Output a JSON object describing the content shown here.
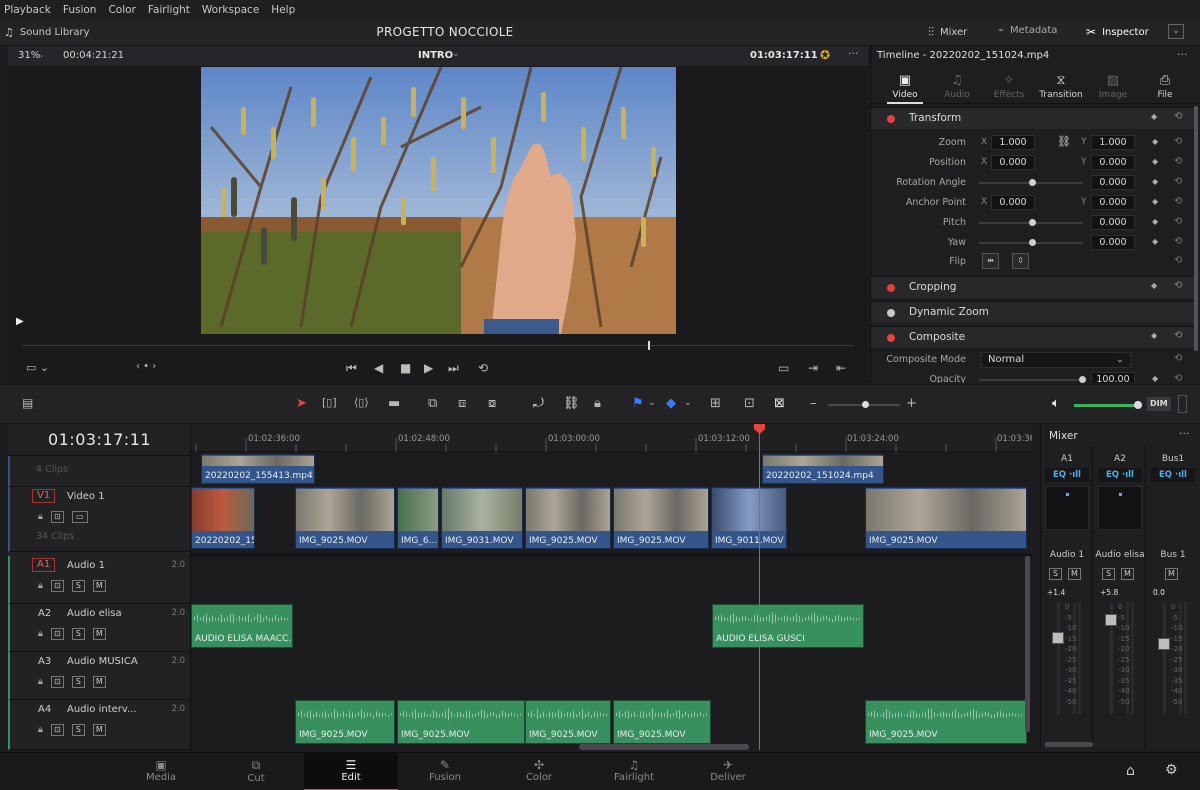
{
  "menu": [
    "Playback",
    "Fusion",
    "Color",
    "Fairlight",
    "Workspace",
    "Help"
  ],
  "header": {
    "sound_library": "Sound Library",
    "project_title": "PROGETTO NOCCIOLE",
    "mixer": "Mixer",
    "metadata": "Metadata",
    "inspector": "Inspector"
  },
  "viewer": {
    "zoom": "31%",
    "duration": "00:04:21:21",
    "clip_name": "INTRO",
    "timecode": "01:03:17:11"
  },
  "inspector": {
    "title": "Timeline - 20220202_151024.mp4",
    "tabs": [
      "Video",
      "Audio",
      "Effects",
      "Transition",
      "Image",
      "File"
    ],
    "sections": [
      "Transform",
      "Cropping",
      "Dynamic Zoom",
      "Composite"
    ],
    "transform": {
      "zoom_label": "Zoom",
      "zoom_x": "1.000",
      "zoom_y": "1.000",
      "position_label": "Position",
      "position_x": "0.000",
      "position_y": "0.000",
      "rotation_label": "Rotation Angle",
      "rotation": "0.000",
      "anchor_label": "Anchor Point",
      "anchor_x": "0.000",
      "anchor_y": "0.000",
      "pitch_label": "Pitch",
      "pitch": "0.000",
      "yaw_label": "Yaw",
      "yaw": "0.000",
      "flip_label": "Flip"
    },
    "composite": {
      "mode_label": "Composite Mode",
      "mode_value": "Normal",
      "opacity_label": "Opacity",
      "opacity_value": "100.00"
    },
    "axis": {
      "x": "X",
      "y": "Y"
    }
  },
  "timeline": {
    "timecode": "01:03:17:11",
    "ruler": [
      "01:02:36:00",
      "01:02:48:00",
      "01:03:00:00",
      "01:03:12:00",
      "01:03:24:00",
      "01:03:36"
    ],
    "upper": {
      "clips_count": "4 Clips",
      "clips": [
        "20220202_155413.mp4",
        "20220202_151024.mp4"
      ]
    },
    "video1": {
      "id": "V1",
      "name": "Video 1",
      "clips_count": "34 Clips",
      "clips": [
        "20220202_15...",
        "IMG_9025.MOV",
        "IMG_6...",
        "IMG_9031.MOV",
        "IMG_9025.MOV",
        "IMG_9025.MOV",
        "IMG_9011.MOV",
        "IMG_9025.MOV"
      ]
    },
    "audio_tracks": [
      {
        "id": "A1",
        "name": "Audio 1",
        "ch": "2.0"
      },
      {
        "id": "A2",
        "name": "Audio elisa",
        "ch": "2.0"
      },
      {
        "id": "A3",
        "name": "Audio MUSICA",
        "ch": "2.0"
      },
      {
        "id": "A4",
        "name": "Audio interv...",
        "ch": "2.0"
      }
    ],
    "a2_clips": [
      "AUDIO ELISA MAACC...",
      "AUDIO ELISA GUSCI"
    ],
    "a4_clips": [
      "IMG_9025.MOV",
      "IMG_9025.MOV",
      "IMG_9025.MOV",
      "IMG_9025.MOV",
      "IMG_9025.MOV"
    ],
    "track_buttons": {
      "solo": "S",
      "mute": "M"
    }
  },
  "mixer": {
    "title": "Mixer",
    "columns": [
      "A1",
      "A2",
      "Bus1"
    ],
    "eq": "EQ",
    "names": [
      "Audio 1",
      "Audio elisa",
      "Bus 1"
    ],
    "gains": [
      "+1.4",
      "+5.8",
      "0.0"
    ],
    "db_scale": [
      "0",
      "-5",
      "-10",
      "-15",
      "-20",
      "-25",
      "-30",
      "-35",
      "-40",
      "-50"
    ]
  },
  "toolbar": {
    "dim": "DIM"
  },
  "pages": [
    "Media",
    "Cut",
    "Edit",
    "Fusion",
    "Color",
    "Fairlight",
    "Deliver"
  ],
  "pages_active": "Edit"
}
